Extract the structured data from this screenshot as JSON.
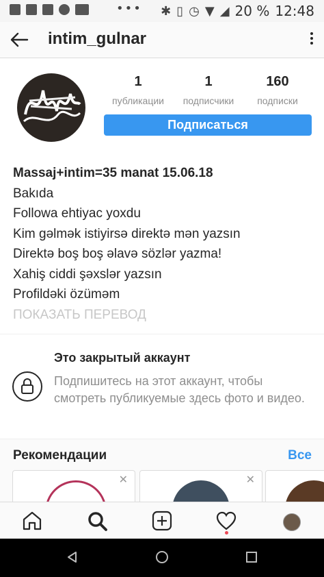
{
  "status_bar": {
    "time": "12:48",
    "battery": "20 %"
  },
  "header": {
    "username": "intim_gulnar"
  },
  "profile": {
    "stats": [
      {
        "value": "1",
        "label": "публикации"
      },
      {
        "value": "1",
        "label": "подписчики"
      },
      {
        "value": "160",
        "label": "подписки"
      }
    ],
    "follow_label": "Подписаться",
    "bio_lines": [
      "Massaj+intim=35 manat 15.06.18",
      "Bakıda",
      "Followa ehtiyac yoxdu",
      "Kim gəlmək istiyirsə direktə mən yazsın",
      "Direktə boş boş əlavə sözlər yazma!",
      "Xahiş ciddi şəxslər yazsın",
      "Profildəki özüməm"
    ],
    "translate_label": "ПОКАЗАТЬ ПЕРЕВОД"
  },
  "private_notice": {
    "title": "Это закрытый аккаунт",
    "text": "Подпишитесь на этот аккаунт, чтобы смотреть публикуемые здесь фото и видео."
  },
  "recommendations": {
    "title": "Рекомендации",
    "see_all": "Все"
  },
  "bottom_nav": [
    "home-icon",
    "search-icon",
    "new-post-icon",
    "activity-heart-icon",
    "profile-avatar"
  ],
  "colors": {
    "accent": "#3897f0",
    "notification": "#ed4956"
  }
}
